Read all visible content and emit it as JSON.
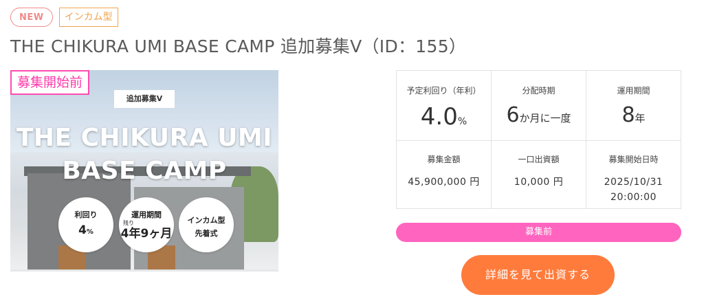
{
  "badges": {
    "new": "NEW",
    "type": "インカム型"
  },
  "title": "THE CHIKURA UMI BASE CAMP 追加募集Ⅴ（ID：155）",
  "photo": {
    "status_tag": "募集開始前",
    "chip": "追加募集Ⅴ",
    "title_line1": "THE CHIKURA UMI",
    "title_line2": "BASE CAMP",
    "circles": [
      {
        "label": "利回り",
        "value": "4",
        "unit": "%"
      },
      {
        "label": "運用期間",
        "prefix": "残り",
        "value": "4年9ヶ月"
      },
      {
        "label": "インカム型",
        "label2": "先着式"
      }
    ]
  },
  "grid": {
    "yield_label": "予定利回り（年利）",
    "yield_value": "4.0",
    "yield_unit": "%",
    "dist_label": "分配時期",
    "dist_num": "6",
    "dist_text": "か月に一度",
    "period_label": "運用期間",
    "period_value": "8",
    "period_unit": "年",
    "amount_label": "募集金額",
    "amount_value": "45,900,000 円",
    "unit_label": "一口出資額",
    "unit_value": "10,000 円",
    "start_label": "募集開始日時",
    "start_date": "2025/10/31",
    "start_time": "20:00:00"
  },
  "status_bar": "募集前",
  "cta": "詳細を見て出資する",
  "colors": {
    "new_badge": "#f08a8a",
    "type_badge": "#f2a34d",
    "status_pink": "#ff64bf",
    "cta_orange": "#ff7b3c"
  }
}
